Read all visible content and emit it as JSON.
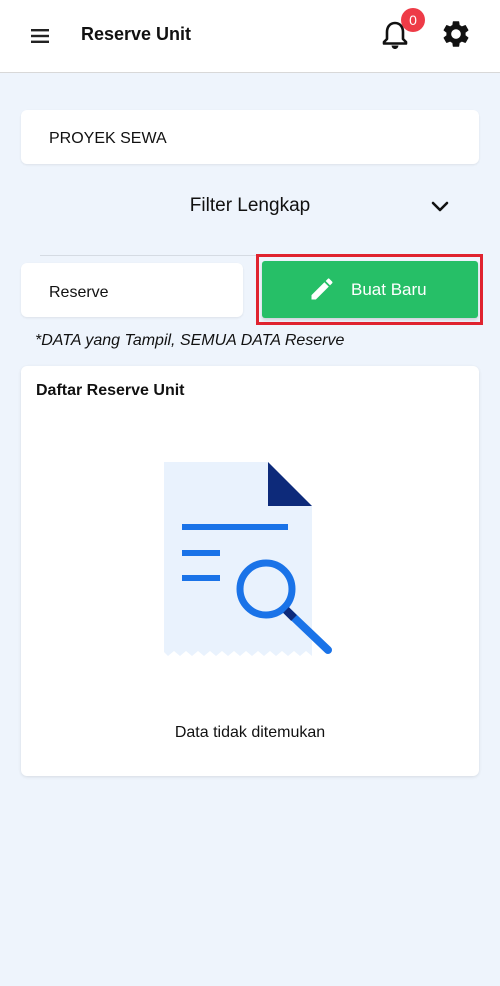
{
  "appbar": {
    "title": "Reserve Unit",
    "notification_count": "0",
    "icons": [
      "menu-icon",
      "bell-icon",
      "gear-icon"
    ]
  },
  "project": {
    "value": "PROYEK SEWA"
  },
  "filter": {
    "label": "Filter Lengkap",
    "icon": "chevron-down-icon"
  },
  "reserve_type": {
    "value": "Reserve"
  },
  "new_button": {
    "label": "Buat Baru",
    "icon": "pencil-icon"
  },
  "note": "*DATA yang Tampil, SEMUA DATA Reserve",
  "list": {
    "title": "Daftar Reserve Unit",
    "empty_message": "Data tidak ditemukan",
    "icon": "empty-document-search-icon"
  },
  "colors": {
    "background": "#eef4fc",
    "primary_button": "#26bf67",
    "badge": "#ee3b47",
    "highlight_border": "#e0232f",
    "illustration_blue": "#1a73e8",
    "illustration_dark": "#0d2a7a"
  }
}
